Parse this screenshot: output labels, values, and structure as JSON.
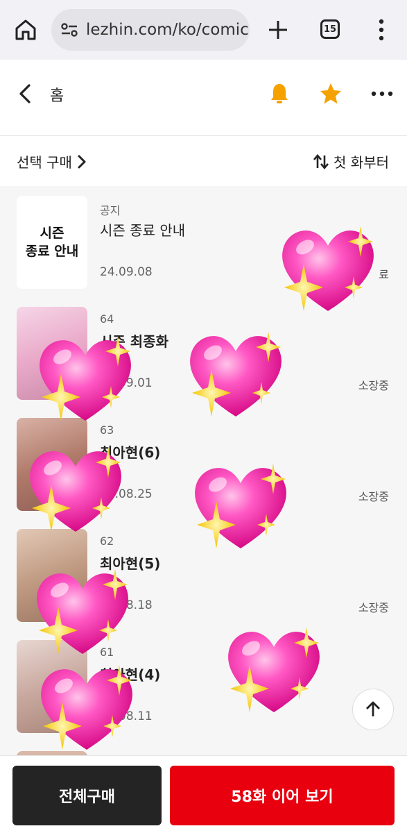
{
  "browser": {
    "url": "lezhin.com/ko/comic/",
    "tab_count": "15",
    "icons": [
      "home-icon",
      "site-settings-icon",
      "new-tab-icon",
      "tab-switcher-icon",
      "menu-kebab-icon"
    ]
  },
  "header": {
    "back_label": "홈",
    "icons": [
      "back-chevron-icon",
      "bell-icon",
      "star-icon",
      "more-dots-icon"
    ],
    "accent_color": "#f5a200"
  },
  "toolbar": {
    "select_purchase": "선택 구매",
    "sort_label": "첫 화부터"
  },
  "episodes": [
    {
      "number": "공지",
      "title": "시즌 종료 안내",
      "date": "24.09.08",
      "status": "료",
      "thumb_text": "시즌\n종료 안내"
    },
    {
      "number": "64",
      "title": "시즌 최종화",
      "date": "24.09.01",
      "status": "소장중"
    },
    {
      "number": "63",
      "title": "최아현(6)",
      "date": "24.08.25",
      "status": "소장중"
    },
    {
      "number": "62",
      "title": "최아현(5)",
      "date": "24.08.18",
      "status": "소장중"
    },
    {
      "number": "61",
      "title": "최아현(4)",
      "date": "24.08.11",
      "status": ""
    }
  ],
  "bottom": {
    "buy_all": "전체구매",
    "continue": "58화 이어 보기",
    "buy_all_color": "#242424",
    "continue_color": "#e8000f"
  },
  "overlay": {
    "sticker": "sparkling-heart-emoji",
    "count": 7
  }
}
